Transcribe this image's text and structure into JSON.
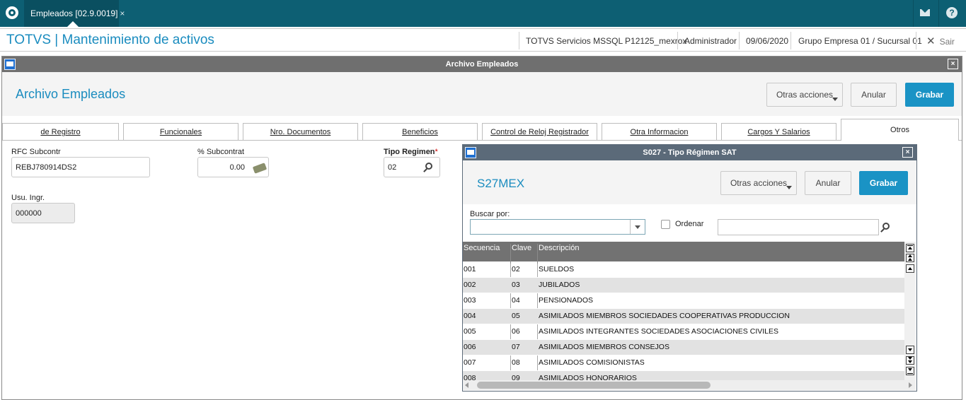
{
  "topbar": {
    "tab_label": "Empleados [02.9.0019]",
    "tab_close": "×",
    "help_glyph": "?"
  },
  "titlebar": {
    "app_title": "TOTVS | Mantenimiento de activos",
    "environment": "TOTVS Servicios MSSQL P12125_mexrox",
    "user": "Administrador",
    "date": "09/06/2020",
    "company": "Grupo Empresa 01 / Sucursal 01",
    "exit_label": "Sair",
    "exit_glyph": "✕"
  },
  "window": {
    "title": "Archivo Empleados",
    "heading": "Archivo Empleados",
    "close_glyph": "×",
    "actions": {
      "other": "Otras acciones",
      "cancel": "Anular",
      "save": "Grabar"
    },
    "tabs": [
      {
        "label": "de Registro"
      },
      {
        "label": "Funcionales"
      },
      {
        "label": "Nro. Documentos"
      },
      {
        "label": "Beneficios"
      },
      {
        "label": "Control de Reloj Registrador"
      },
      {
        "label": "Otra Informacion"
      },
      {
        "label": "Cargos Y Salarios"
      },
      {
        "label": "Otros"
      }
    ],
    "form": {
      "rfc_label": "RFC Subcontr",
      "rfc_value": "REBJ780914DS2",
      "subcontrat_label": "% Subcontrat",
      "subcontrat_value": "0.00",
      "regimen_label": "Tipo Regimen",
      "regimen_required": "*",
      "regimen_value": "02",
      "usu_label": "Usu. Ingr.",
      "usu_value": "000000"
    }
  },
  "dialog": {
    "title": "S027 - Tipo Régimen SAT",
    "heading": "S27MEX",
    "close_glyph": "×",
    "actions": {
      "other": "Otras acciones",
      "cancel": "Anular",
      "save": "Grabar"
    },
    "search": {
      "label": "Buscar por:",
      "order_label": "Ordenar"
    },
    "grid": {
      "columns": [
        "Secuencia",
        "Clave",
        "Descripción"
      ],
      "rows": [
        [
          "001",
          "02",
          "SUELDOS"
        ],
        [
          "002",
          "03",
          "JUBILADOS"
        ],
        [
          "003",
          "04",
          "PENSIONADOS"
        ],
        [
          "004",
          "05",
          "ASIMILADOS MIEMBROS SOCIEDADES COOPERATIVAS PRODUCCION"
        ],
        [
          "005",
          "06",
          "ASIMILADOS INTEGRANTES SOCIEDADES ASOCIACIONES CIVILES"
        ],
        [
          "006",
          "07",
          "ASIMILADOS MIEMBROS CONSEJOS"
        ],
        [
          "007",
          "08",
          "ASIMILADOS COMISIONISTAS"
        ],
        [
          "008",
          "09",
          "ASIMILADOS HONORARIOS"
        ]
      ]
    }
  },
  "colors": {
    "topbar": "#0d5f73",
    "accent": "#1a93c5",
    "title_text": "#1a8cbf",
    "grid_header": "#727272"
  }
}
